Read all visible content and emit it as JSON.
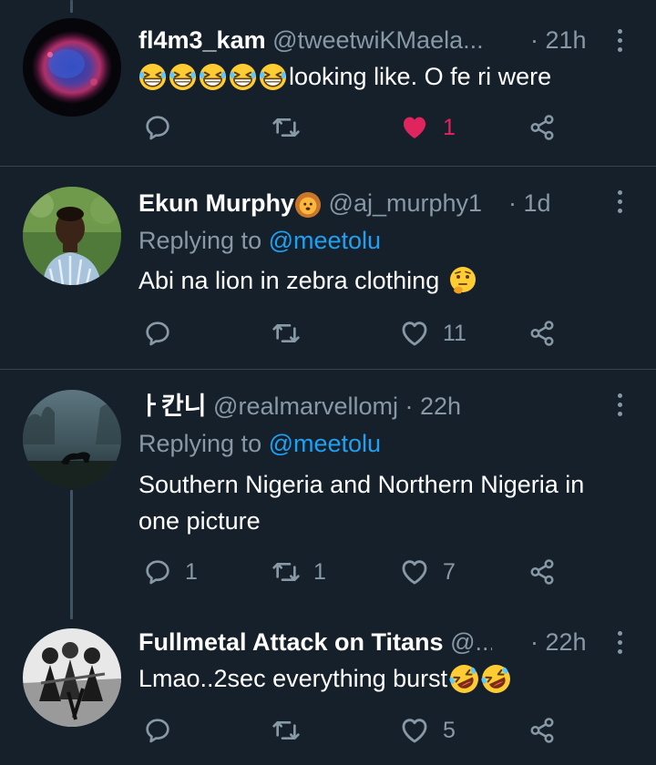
{
  "colors": {
    "background": "#15202b",
    "divider": "#38444d",
    "muted": "#8899a6",
    "link": "#1da1f2",
    "like": "#e0245e"
  },
  "tweets": [
    {
      "name": "fl4m3_kam",
      "handle": "@tweetwiKMaela...",
      "time": "· 21h",
      "text": "looking like. O fe ri were",
      "emojis": [
        "grinning-squinting-face",
        "grinning-squinting-face",
        "grinning-squinting-face",
        "grinning-squinting-face",
        "grinning-squinting-face"
      ],
      "avatar": "nebula-avatar",
      "replies": "",
      "retweets": "",
      "likes": "1",
      "liked": true
    },
    {
      "name": "Ekun Murphy",
      "name_emoji": "lion-face",
      "handle": "@aj_murphy1",
      "time": "· 1d",
      "replying_prefix": "Replying to",
      "replying_to": "@meetolu",
      "text": "Abi na lion in zebra clothing",
      "text_emoji": "thinking-face",
      "avatar": "man-portrait-avatar",
      "replies": "",
      "retweets": "",
      "likes": "11",
      "liked": false
    },
    {
      "name": "ㅏ칸니",
      "handle": "@realmarvellomj",
      "time": "· 22h",
      "replying_prefix": "Replying to",
      "replying_to": "@meetolu",
      "text_line1": "Southern Nigeria and Northern Nigeria in",
      "text_line2": "one picture",
      "avatar": "panther-fog-avatar",
      "replies": "1",
      "retweets": "1",
      "likes": "7",
      "liked": false
    },
    {
      "name": "Fullmetal Attack on Titans",
      "handle": "@...",
      "time": "· 22h",
      "text": "Lmao..2sec everything burst",
      "text_emojis": [
        "rolling-on-floor-laughing",
        "rolling-on-floor-laughing"
      ],
      "avatar": "anime-group-avatar",
      "replies": "",
      "retweets": "",
      "likes": "5",
      "liked": false
    }
  ]
}
